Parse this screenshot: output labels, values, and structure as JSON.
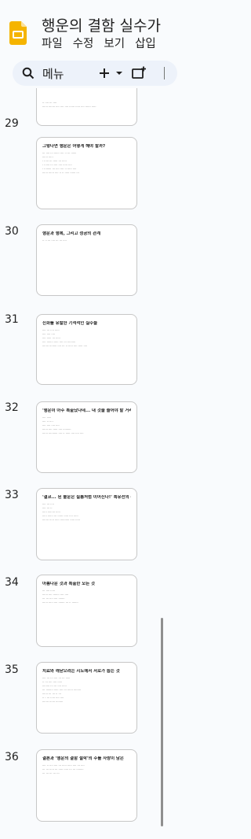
{
  "header": {
    "title": "행운의 결함 실수가",
    "menu": [
      "파일",
      "수정",
      "보기",
      "삽입"
    ]
  },
  "toolbar": {
    "search_label": "메뉴",
    "icons": [
      "search-icon",
      "plus-icon",
      "dropdown-arrow-icon",
      "new-slide-icon"
    ]
  },
  "slides": [
    {
      "number": "",
      "title": "",
      "lines": [
        "·· ···· ··· ····",
        "······ ······· ···· ···· ···· ······ ····· ···· ······ ·····"
      ]
    },
    {
      "number": "29",
      "title": "그렇다면 행운은 어떻게 해야 할까?",
      "lines": [
        "··· ···· ··· ······ ···· ·· ··· ······",
        "······ ·····",
        "· ····· ··· ····· ··· ·····",
        "· ······ ··· ···· ···· ····· ····",
        "· ········ ··· ···· ···· ·· ····· ····",
        "······ ······ ···· ·· ·· ····· ······ ···"
      ]
    },
    {
      "number": "30",
      "title": "행운과 행복, 그리고 성공의 관계",
      "lines": [
        "·· ·· ··· ···· ··· ··· ····"
      ]
    },
    {
      "number": "31",
      "title": "진화를 유발한 기적적인 실수들",
      "lines": [
        "···· ··· ···· ·····",
        "···· ···· ····",
        "···· ····· ··· ·····",
        "···· ······· ····· ···· ··· ·········",
        "······· ········ ···· ··· ·· ····· ···· ····· ····"
      ]
    },
    {
      "number": "32",
      "title": "'행운이 아주 특출났다네... 내 것을 줄어야 할 거라?'",
      "lines": [
        "···· ·····",
        "···· ·· ····",
        "···· ···· ···· ····",
        "······ ···· ····· ···· ·········",
        "······ ·········· ···· ·· ····· ···· ···· ····"
      ]
    },
    {
      "number": "33",
      "title": "'결코... 된 불운은 필름처럼 이어진다!' 특유전의 순서로",
      "lines": [
        "···· ··· ····",
        "···· ··· ··",
        "····· ········ ·····",
        "····· ······ ··· ······ ····· ···· ·····",
        "······· ····· ····· ·········· ····· ·····"
      ]
    },
    {
      "number": "34",
      "title": "아름다운 것과 특출한 모든 것",
      "lines": [
        "··· ···· ·····",
        "······ ···· ······· ···· ····",
        "",
        "··· ··· ···· ···· ·······",
        "",
        "······ ····· ···· ······· ··· ·· ·······"
      ]
    },
    {
      "number": "35",
      "title": "치료와 깨닫으려는 시도에서 서로가 돕는 것",
      "lines": [
        "···· ··· ··· ···· ··· ··· ·····",
        "·· ··· ···· ···· ·····",
        "········ ··· ··· ···· ·····",
        "··· ········ ····· ···· ··· ······ ········",
        "······ ··· ··· ·· ···",
        "·· · ··· ····· ···· ····",
        "······· ······ ········"
      ]
    },
    {
      "number": "36",
      "title": "결론과 '행운의 결함 철학'의 주를 자랑이 남은",
      "lines": [
        "···· ·· ···· ···· ··· ····· ····· ···· ··· ····",
        "··· ··· ····· ··· ····· ····· ··· ··· ········",
        "··· ··· ··· ··· ···"
      ]
    }
  ]
}
